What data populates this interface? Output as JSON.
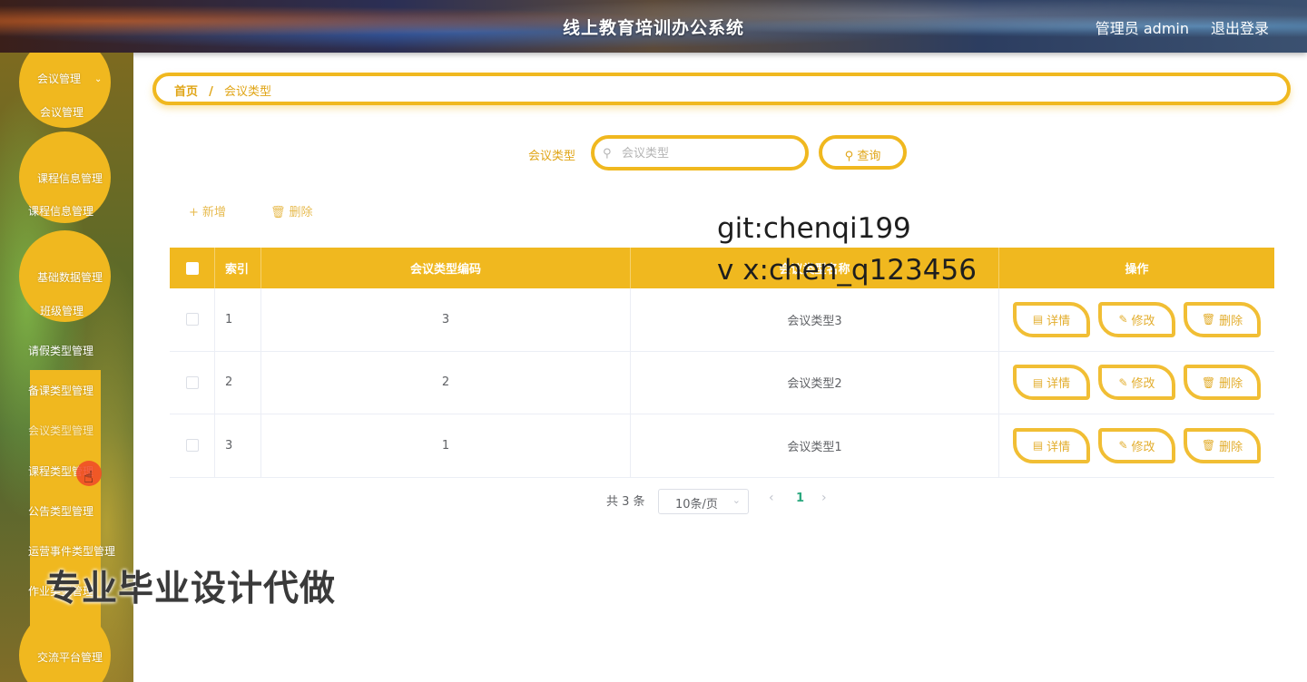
{
  "header": {
    "title": "线上教育培训办公系统",
    "user": "管理员 admin",
    "logout": "退出登录"
  },
  "sidebar": {
    "items": [
      {
        "label": "会议管理"
      },
      {
        "label": "会议管理"
      },
      {
        "label": "课程信息管理"
      },
      {
        "label": "课程信息管理"
      },
      {
        "label": "基础数据管理"
      },
      {
        "label": "班级管理"
      },
      {
        "label": "请假类型管理"
      },
      {
        "label": "备课类型管理"
      },
      {
        "label": "会议类型管理"
      },
      {
        "label": "课程类型管理"
      },
      {
        "label": "公告类型管理"
      },
      {
        "label": "运营事件类型管理"
      },
      {
        "label": "作业类型管理"
      },
      {
        "label": "交流平台管理"
      }
    ]
  },
  "breadcrumb": {
    "home": "首页",
    "sep": "/",
    "current": "会议类型"
  },
  "search": {
    "label": "会议类型",
    "placeholder": "会议类型",
    "button": "查询",
    "icon": "search-icon"
  },
  "actions": {
    "add": "新增",
    "delete": "删除"
  },
  "watermarks": {
    "git": "git:chenqi199",
    "vx": "v x:chen_q123456",
    "ad": "专业毕业设计代做"
  },
  "table": {
    "headers": {
      "index": "索引",
      "code": "会议类型编码",
      "name": "会议类型名称",
      "op": "操作"
    },
    "rows": [
      {
        "index": "1",
        "code": "3",
        "name": "会议类型3"
      },
      {
        "index": "2",
        "code": "2",
        "name": "会议类型2"
      },
      {
        "index": "3",
        "code": "1",
        "name": "会议类型1"
      }
    ],
    "row_actions": {
      "detail": "详情",
      "edit": "修改",
      "delete": "删除"
    }
  },
  "pagination": {
    "total": "共 3 条",
    "page_size": "10条/页",
    "current": "1"
  },
  "colors": {
    "accent": "#f0b81f",
    "accent_text": "#e0a516",
    "page_active": "#2aa87e"
  }
}
